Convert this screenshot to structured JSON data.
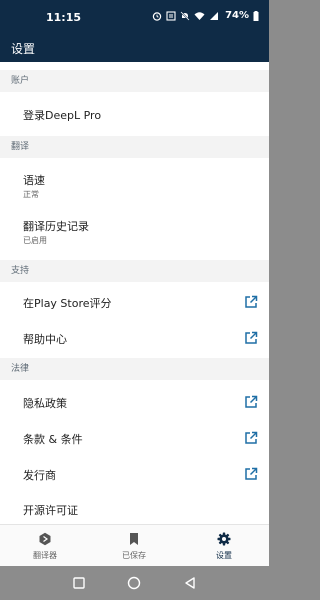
{
  "status_bar": {
    "time": "11:15",
    "battery": "74%",
    "icons": [
      "alarm-icon",
      "data-saver-icon",
      "mute-icon",
      "wifi-icon",
      "signal-icon",
      "battery-icon"
    ]
  },
  "app_bar": {
    "title": "设置"
  },
  "sections": {
    "account": {
      "header": "账户",
      "items": [
        {
          "label": "登录DeepL Pro"
        }
      ]
    },
    "translation": {
      "header": "翻译",
      "items": [
        {
          "label": "语速",
          "sub": "正常"
        },
        {
          "label": "翻译历史记录",
          "sub": "已启用"
        }
      ]
    },
    "support": {
      "header": "支持",
      "items": [
        {
          "label": "在Play Store评分",
          "icon": "external-link-icon"
        },
        {
          "label": "帮助中心",
          "icon": "external-link-icon"
        }
      ]
    },
    "legal": {
      "header": "法律",
      "items": [
        {
          "label": "隐私政策",
          "icon": "external-link-icon"
        },
        {
          "label": "条款 & 条件",
          "icon": "external-link-icon"
        },
        {
          "label": "发行商",
          "icon": "external-link-icon"
        },
        {
          "label": "开源许可证"
        }
      ]
    }
  },
  "bottom_nav": {
    "tabs": [
      {
        "label": "翻译器",
        "icon": "translator-icon"
      },
      {
        "label": "已保存",
        "icon": "bookmark-icon"
      },
      {
        "label": "设置",
        "icon": "gear-icon",
        "active": true
      }
    ]
  },
  "colors": {
    "primary": "#0f2b46",
    "link_icon": "#1f6fa6",
    "section_bg": "#f3f3f3"
  }
}
